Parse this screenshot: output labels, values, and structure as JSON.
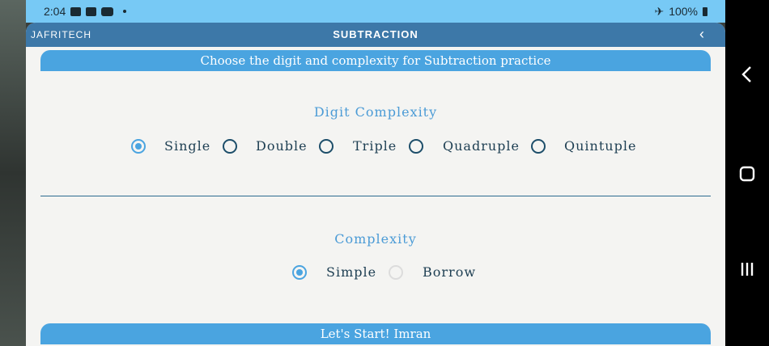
{
  "status": {
    "time": "2:04",
    "battery": "100%",
    "icons": [
      "image-icon",
      "nfc-icon",
      "youtube-icon",
      "dot-icon"
    ],
    "right_icons": [
      "airplane-icon",
      "battery-icon"
    ]
  },
  "appbar": {
    "brand": "JAFRITECH",
    "title": "SUBTRACTION",
    "back": "‹"
  },
  "header_banner": "Choose the digit and complexity for Subtraction practice",
  "digit_section": {
    "title": "Digit Complexity",
    "options": [
      "Single",
      "Double",
      "Triple",
      "Quadruple",
      "Quintuple"
    ],
    "selected": "Single"
  },
  "complexity_section": {
    "title": "Complexity",
    "options": [
      "Simple",
      "Borrow"
    ],
    "selected": "Simple"
  },
  "start_button": "Let's Start! Imran",
  "colors": {
    "accent": "#4aa4e0",
    "appbar": "#3d78a8",
    "statusbar": "#77c9f5",
    "text_dark": "#1d3e52"
  }
}
